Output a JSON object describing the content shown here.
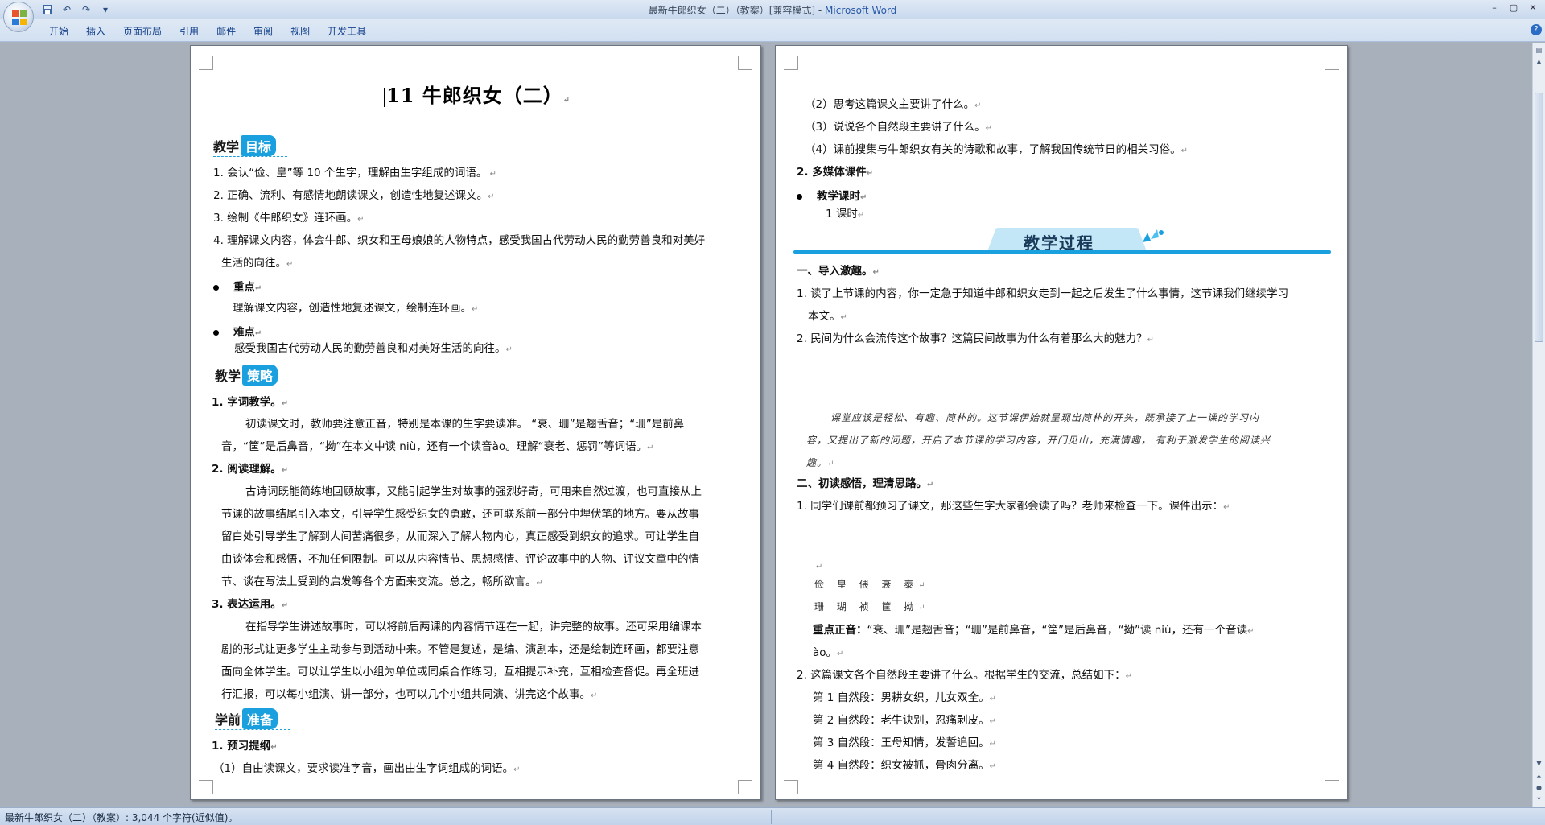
{
  "window": {
    "title": "最新牛郎织女（二）（教案）[兼容模式]",
    "separator": " - ",
    "app": "Microsoft Word",
    "controls": [
      "–",
      "▢",
      "✕"
    ]
  },
  "qat": {
    "save_icon": "save-icon",
    "undo_icon": "undo-icon",
    "redo_icon": "redo-icon",
    "customize_icon": "dropdown-icon"
  },
  "ribbon": {
    "tabs": [
      "开始",
      "插入",
      "页面布局",
      "引用",
      "邮件",
      "审阅",
      "视图",
      "开发工具"
    ],
    "help": "?"
  },
  "page1": {
    "title": "11  牛郎织女（二）",
    "sec1": {
      "a": "教学",
      "b": "目标"
    },
    "goals": [
      "1. 会认“俭、皇”等 10 个生字，理解由生字组成的词语。",
      "2. 正确、流利、有感情地朗读课文，创造性地复述课文。",
      "3. 绘制《牛郎织女》连环画。",
      "4. 理解课文内容，体会牛郎、织女和王母娘娘的人物特点，感受我国古代劳动人民的勤劳善良和对美好",
      "生活的向往。"
    ],
    "key_label": "重点",
    "key_text": "理解课文内容，创造性地复述课文，绘制连环画。",
    "diff_label": "难点",
    "diff_text": "感受我国古代劳动人民的勤劳善良和对美好生活的向往。",
    "sec2": {
      "a": "教学",
      "b": "策略"
    },
    "s1_title": "1. 字词教学。",
    "s1_lines": [
      "初读课文时，教师要注意正音，特别是本课的生字要读准。  “衰、珊”是翘舌音；“珊”是前鼻",
      "音，“筐”是后鼻音，“拗”在本文中读 niù，还有一个读音ào。理解“衰老、惩罚”等词语。"
    ],
    "s2_title": "2. 阅读理解。",
    "s2_lines": [
      "古诗词既能简练地回顾故事，又能引起学生对故事的强烈好奇，可用来自然过渡，也可直接从上",
      "节课的故事结尾引入本文，引导学生感受织女的勇敢，还可联系前一部分中埋伏笔的地方。要从故事",
      "留白处引导学生了解到人间苦痛很多，从而深入了解人物内心，真正感受到织女的追求。可让学生自",
      "由谈体会和感悟，不加任何限制。可以从内容情节、思想感情、评论故事中的人物、评议文章中的情",
      "节、谈在写法上受到的启发等各个方面来交流。总之，畅所欲言。"
    ],
    "s3_title": "3. 表达运用。",
    "s3_lines": [
      "在指导学生讲述故事时，可以将前后两课的内容情节连在一起，讲完整的故事。还可采用编课本",
      "剧的形式让更多学生主动参与到活动中来。不管是复述，是编、演剧本，还是绘制连环画，都要注意",
      "面向全体学生。可以让学生以小组为单位或同桌合作练习，互相提示补充，互相检查督促。再全班进",
      "行汇报，可以每小组演、讲一部分，也可以几个小组共同演、讲完这个故事。"
    ],
    "sec3": {
      "a": "学前",
      "b": "准备"
    },
    "prep_title": "1. 预习提纲",
    "prep_1": "（1）自由读课文，要求读准字音，画出由生字词组成的词语。"
  },
  "page2": {
    "prep_lines": [
      "（2）思考这篇课文主要讲了什么。",
      "（3）说说各个自然段主要讲了什么。",
      "（4）课前搜集与牛郎织女有关的诗歌和故事，了解我国传统节日的相关习俗。"
    ],
    "media": "2. 多媒体课件",
    "period_label": "教学课时",
    "period_value": "1 课时",
    "banner": "教学过程",
    "part1": "一、导入激趣。",
    "p1_lines": [
      "1. 读了上节课的内容，你一定急于知道牛郎和织女走到一起之后发生了什么事情，这节课我们继续学习",
      "本文。",
      "2. 民间为什么会流传这个故事？这篇民间故事为什么有着那么大的魅力？"
    ],
    "note_lines": [
      "课堂应该是轻松、有趣、简朴的。这节课伊始就呈现出简朴的开头，既承接了上一课的学习内",
      "容，又提出了新的问题，开启了本节课的学习内容，开门见山，充满情趣，  有利于激发学生的阅读兴",
      "趣。"
    ],
    "part2": "二、初读感悟，理清思路。",
    "p2_line": "1. 同学们课前都预习了课文，那这些生字大家都会读了吗？老师来检查一下。课件出示：",
    "chars_1": "俭 皇 偎 衰 泰",
    "chars_2": "珊 瑚 祯 筐 拗",
    "key_label": "重点正音：",
    "key_text": "“衰、珊”是翘舌音；“珊”是前鼻音，“筐”是后鼻音，“拗”读 niù，还有一个音读",
    "key_text2": "ào。",
    "summary": "2. 这篇课文各个自然段主要讲了什么。根据学生的交流，总结如下：",
    "paras": [
      "第 1 自然段：男耕女织，儿女双全。",
      "第 2 自然段：老牛诀别，忍痛剥皮。",
      "第 3 自然段：王母知情，发誓追回。",
      "第 4 自然段：织女被抓，骨肉分离。"
    ]
  },
  "status": {
    "text": "最新牛郎织女（二）（教案）: 3,044 个字符(近似值)。"
  },
  "colors": {
    "accent": "#1aa0de",
    "ribbon_text": "#15428b",
    "app_blue": "#2a5aa7"
  }
}
